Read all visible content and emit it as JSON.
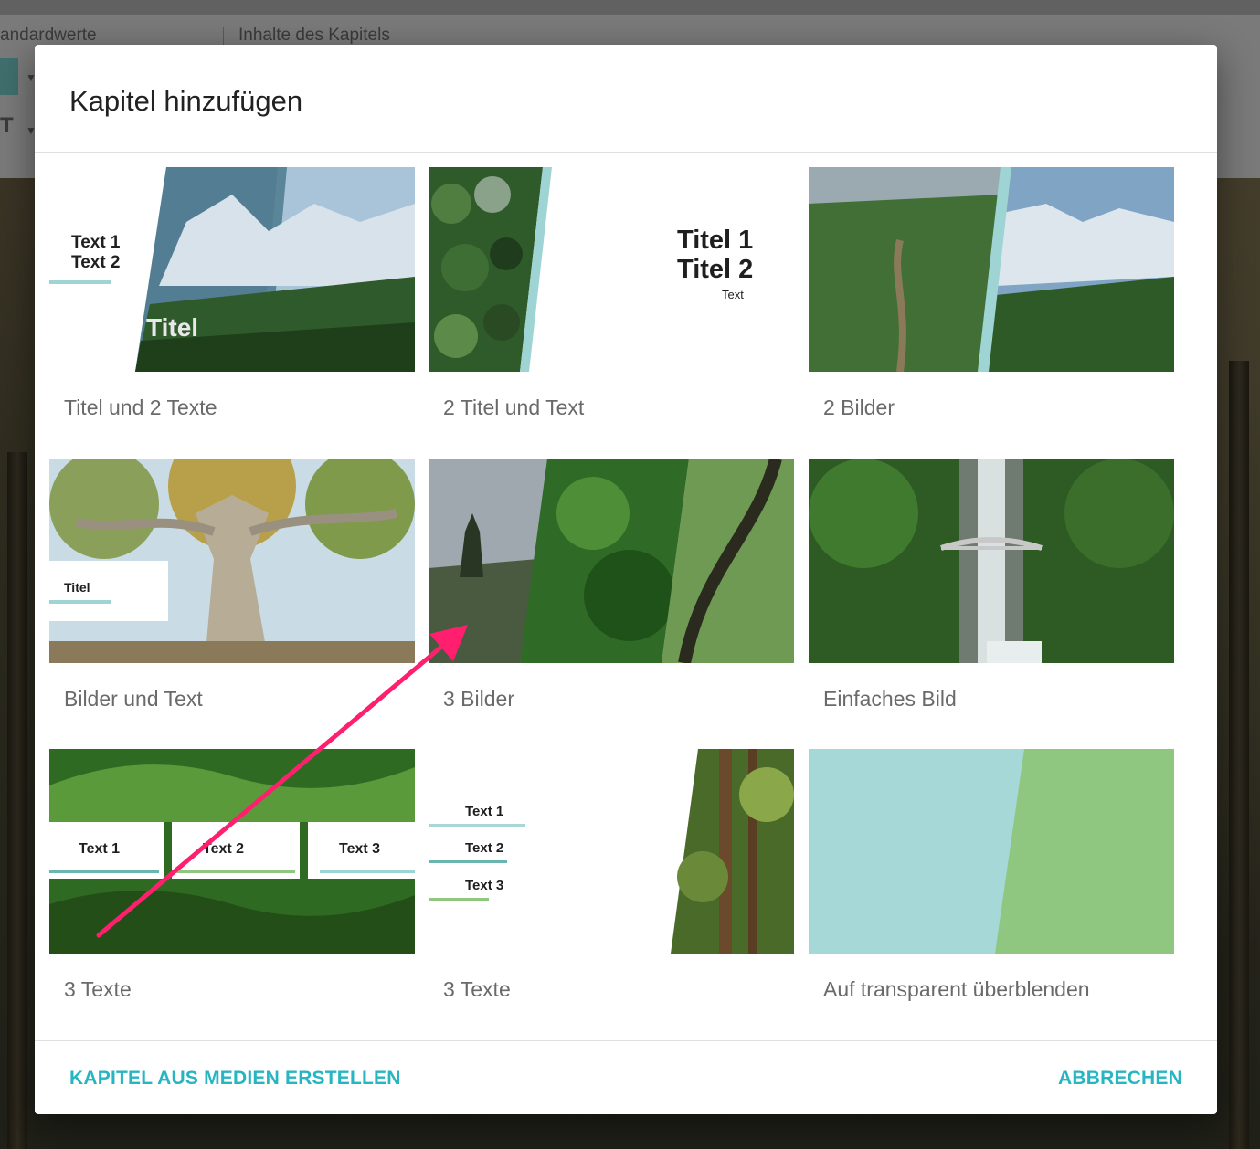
{
  "background": {
    "tab_left": "andardwerte",
    "tab_right": "Inhalte des Kapitels"
  },
  "dialog": {
    "title": "Kapitel hinzufügen",
    "templates": [
      {
        "label": "Titel und 2 Texte",
        "preview_texts": [
          "Text 1",
          "Text 2",
          "Titel"
        ]
      },
      {
        "label": "2 Titel und Text",
        "preview_texts": [
          "Titel 1",
          "Titel 2",
          "Text"
        ]
      },
      {
        "label": "2 Bilder",
        "preview_texts": []
      },
      {
        "label": "Bilder und Text",
        "preview_texts": [
          "Titel"
        ]
      },
      {
        "label": "3 Bilder",
        "preview_texts": []
      },
      {
        "label": "Einfaches Bild",
        "preview_texts": []
      },
      {
        "label": "3 Texte",
        "preview_texts": [
          "Text 1",
          "Text 2",
          "Text 3"
        ]
      },
      {
        "label": "3 Texte",
        "preview_texts": [
          "Text 1",
          "Text 2",
          "Text 3"
        ]
      },
      {
        "label": "Auf transparent überblenden",
        "preview_texts": []
      }
    ],
    "actions": {
      "create_from_media": "KAPITEL AUS MEDIEN ERSTELLEN",
      "cancel": "ABBRECHEN"
    }
  },
  "colors": {
    "accent": "#26b5c1",
    "annotation_arrow": "#ff1f6e",
    "teal_swatch": "#a6d8d8",
    "green_swatch": "#8fc680"
  }
}
